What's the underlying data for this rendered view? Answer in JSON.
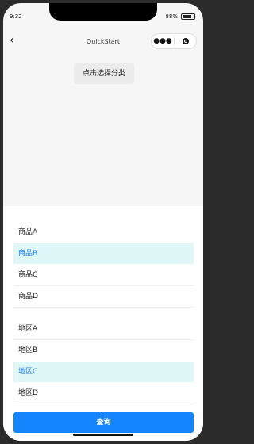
{
  "status": {
    "time": "9:32",
    "battery": "88%"
  },
  "nav": {
    "title": "QuickStart",
    "back_icon": "chevron-left-icon",
    "more_icon": "more-dots-icon",
    "close_icon": "target-circle-icon"
  },
  "page": {
    "select_button": "点击选择分类"
  },
  "picker": {
    "products": [
      {
        "label": "商品A",
        "selected": false
      },
      {
        "label": "商品B",
        "selected": true
      },
      {
        "label": "商品C",
        "selected": false
      },
      {
        "label": "商品D",
        "selected": false
      }
    ],
    "regions": [
      {
        "label": "地区A",
        "selected": false
      },
      {
        "label": "地区B",
        "selected": false
      },
      {
        "label": "地区C",
        "selected": true
      },
      {
        "label": "地区D",
        "selected": false
      }
    ],
    "query_button": "查询"
  },
  "colors": {
    "accent": "#1485ff",
    "selected_bg": "#e0f7f8",
    "selected_text": "#1e82ff"
  }
}
